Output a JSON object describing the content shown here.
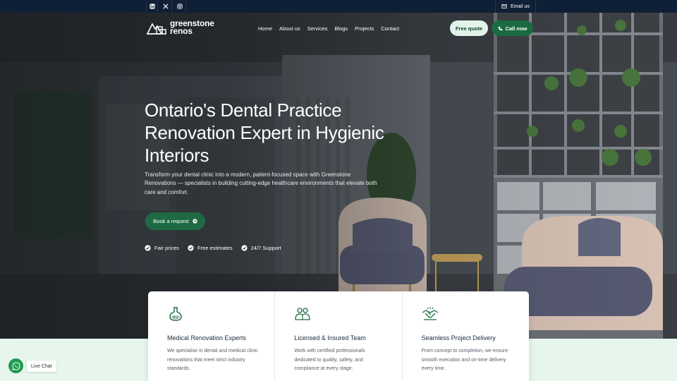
{
  "topbar": {
    "socials": [
      {
        "icon": "linkedin-icon"
      },
      {
        "icon": "x-icon"
      },
      {
        "icon": "instagram-icon"
      }
    ],
    "email_label": "Email us"
  },
  "brand": {
    "logo_line1": "greenstone",
    "logo_line2": "renos"
  },
  "nav": {
    "items": [
      "Home",
      "About us",
      "Services",
      "Blogs",
      "Projects",
      "Contact"
    ]
  },
  "header_actions": {
    "quote_label": "Free quote",
    "call_label": "Call now"
  },
  "hero": {
    "title": "Ontario's Dental Practice Renovation Expert in Hygienic Interiors",
    "subtitle": "Transform your dental clinic into a modern, patient-focused space with Greenstone Renovations — specialists in building cutting-edge healthcare environments that elevate both care and comfort.",
    "cta_label": "Book a request",
    "checks": [
      "Fair prices",
      "Free estimates",
      "24/7 Support"
    ]
  },
  "features": [
    {
      "icon": "flask-icon",
      "title": "Medical Renovation Experts",
      "text": "We specialise in dental and medical clinic renovations that meet strict industry standards."
    },
    {
      "icon": "team-icon",
      "title": "Licensed & Insured Team",
      "text": "Work with certified professionals dedicated to quality, safety, and compliance at every stage."
    },
    {
      "icon": "handshake-icon",
      "title": "Seamless Project Delivery",
      "text": "From concept to completion, we ensure smooth execution and on-time delivery every time."
    }
  ],
  "chat": {
    "label": "Live Chat"
  },
  "colors": {
    "topbar": "#0f2036",
    "brand_green": "#1b6b41",
    "light_green": "#e7f6ec"
  }
}
